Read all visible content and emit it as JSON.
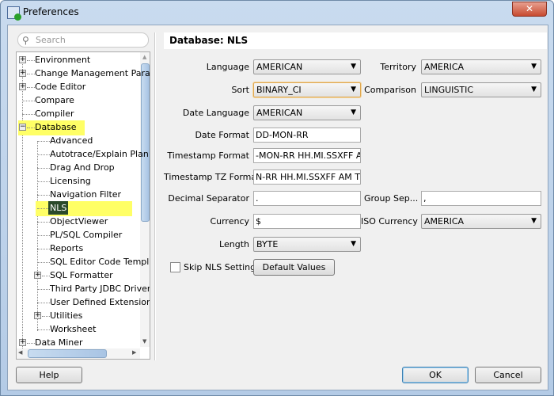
{
  "window": {
    "title": "Preferences",
    "close": "✕"
  },
  "search": {
    "placeholder": "Search"
  },
  "tree": [
    {
      "label": "Environment",
      "level": 0,
      "expander": "+"
    },
    {
      "label": "Change Management Parar",
      "level": 0,
      "expander": "+"
    },
    {
      "label": "Code Editor",
      "level": 0,
      "expander": "+"
    },
    {
      "label": "Compare",
      "level": 0
    },
    {
      "label": "Compiler",
      "level": 0
    },
    {
      "label": "Database",
      "level": 0,
      "expander": "−",
      "highlighted": true
    },
    {
      "label": "Advanced",
      "level": 1
    },
    {
      "label": "Autotrace/Explain Plan",
      "level": 1
    },
    {
      "label": "Drag And Drop",
      "level": 1
    },
    {
      "label": "Licensing",
      "level": 1
    },
    {
      "label": "Navigation Filter",
      "level": 1
    },
    {
      "label": "NLS",
      "level": 1,
      "highlighted": true,
      "selected": true
    },
    {
      "label": "ObjectViewer",
      "level": 1
    },
    {
      "label": "PL/SQL Compiler",
      "level": 1
    },
    {
      "label": "Reports",
      "level": 1
    },
    {
      "label": "SQL Editor Code Templa",
      "level": 1
    },
    {
      "label": "SQL Formatter",
      "level": 1,
      "expander": "+"
    },
    {
      "label": "Third Party JDBC Driver",
      "level": 1
    },
    {
      "label": "User Defined Extension",
      "level": 1
    },
    {
      "label": "Utilities",
      "level": 1,
      "expander": "+"
    },
    {
      "label": "Worksheet",
      "level": 1
    },
    {
      "label": "Data Miner",
      "level": 0,
      "expander": "+"
    }
  ],
  "panel": {
    "title": "Database: NLS"
  },
  "form": {
    "language": {
      "label": "Language",
      "value": "AMERICAN"
    },
    "territory": {
      "label": "Territory",
      "value": "AMERICA"
    },
    "sort": {
      "label": "Sort",
      "value": "BINARY_CI"
    },
    "comparison": {
      "label": "Comparison",
      "value": "LINGUISTIC"
    },
    "date_language": {
      "label": "Date Language",
      "value": "AMERICAN"
    },
    "date_format": {
      "label": "Date Format",
      "value": "DD-MON-RR"
    },
    "timestamp_format": {
      "label": "Timestamp Format",
      "value": "-MON-RR HH.MI.SSXFF AM"
    },
    "timestamp_tz_format": {
      "label": "Timestamp TZ Format",
      "value": "N-RR HH.MI.SSXFF AM TZR"
    },
    "decimal_separator": {
      "label": "Decimal Separator",
      "value": "."
    },
    "group_separator": {
      "label": "Group Sep...",
      "value": ","
    },
    "currency": {
      "label": "Currency",
      "value": "$"
    },
    "iso_currency": {
      "label": "ISO Currency",
      "value": "AMERICA"
    },
    "length": {
      "label": "Length",
      "value": "BYTE"
    },
    "skip_nls": {
      "label": "Skip NLS Settings",
      "checked": false
    },
    "default_values": "Default Values"
  },
  "buttons": {
    "help": "Help",
    "ok": "OK",
    "cancel": "Cancel"
  }
}
